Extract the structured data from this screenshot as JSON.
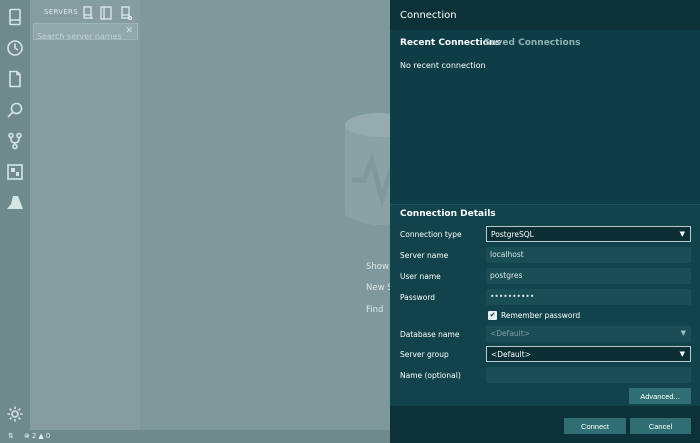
{
  "sidebar": {
    "title": "SERVERS",
    "search_placeholder": "Search server names",
    "clear_glyph": "✕"
  },
  "activity_bar": {
    "icons": [
      "servers-icon",
      "history-icon",
      "file-icon",
      "search-icon",
      "source-control-icon",
      "extensions-icon",
      "azure-icon",
      "settings-gear-icon"
    ]
  },
  "welcome": {
    "link_show": "Show",
    "link_new": "New S",
    "link_find": "Find"
  },
  "statusbar": {
    "errors": "2",
    "warnings": "0"
  },
  "dialog": {
    "title": "Connection",
    "tabs": {
      "recent": "Recent Connections",
      "saved": "Saved Connections"
    },
    "no_recent": "No recent connection",
    "details": {
      "title": "Connection Details",
      "connection_type_label": "Connection type",
      "connection_type_value": "PostgreSQL",
      "server_name_label": "Server name",
      "server_name_value": "localhost",
      "user_name_label": "User name",
      "user_name_value": "postgres",
      "password_label": "Password",
      "password_value": "••••••••••",
      "remember_password_label": "Remember password",
      "remember_password_checked": true,
      "database_name_label": "Database name",
      "database_name_value": "<Default>",
      "server_group_label": "Server group",
      "server_group_value": "<Default>",
      "name_label": "Name (optional)",
      "name_value": ""
    },
    "buttons": {
      "advanced": "Advanced...",
      "connect": "Connect",
      "cancel": "Cancel"
    }
  },
  "colors": {
    "dialog_bg": "#0f3d45",
    "overlay_bg": "#7f989b",
    "button_bg": "#2f6f73"
  }
}
